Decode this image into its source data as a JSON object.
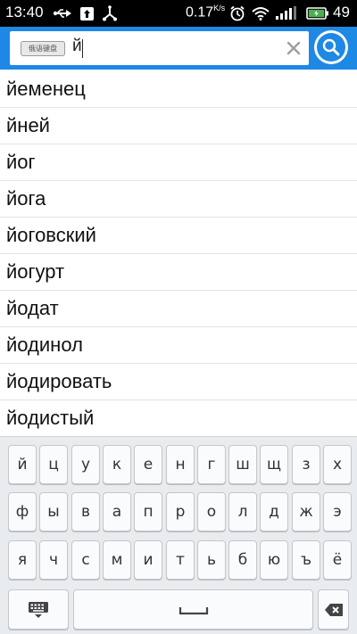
{
  "status_bar": {
    "time": "13:40",
    "network_speed": "0.17",
    "network_speed_unit": "K/s",
    "battery_level": "49",
    "icons": [
      "usb-icon",
      "upload-notification-icon",
      "usb-connection-icon",
      "alarm-clock-icon",
      "wifi-icon",
      "signal-icon",
      "battery-charging-icon"
    ]
  },
  "search": {
    "keyboard_chip_label": "俄语键盘",
    "query": "й",
    "clear_icon": "close-icon",
    "search_icon": "search-icon"
  },
  "suggestions": [
    "йеменец",
    "йней",
    "йог",
    "йога",
    "йоговский",
    "йогурт",
    "йодат",
    "йодинол",
    "йодировать",
    "йодистый"
  ],
  "keyboard": {
    "row1": [
      "й",
      "ц",
      "у",
      "к",
      "е",
      "н",
      "г",
      "ш",
      "щ",
      "з",
      "х"
    ],
    "row2": [
      "ф",
      "ы",
      "в",
      "а",
      "п",
      "р",
      "о",
      "л",
      "д",
      "ж",
      "э"
    ],
    "row3": [
      "я",
      "ч",
      "с",
      "м",
      "и",
      "т",
      "ь",
      "б",
      "ю",
      "ъ",
      "ё"
    ],
    "hide_icon": "keyboard-hide-icon",
    "space_icon": "space-bar-icon",
    "backspace_icon": "backspace-icon"
  },
  "colors": {
    "header_blue": "#1e88e5",
    "status_bar": "#000000",
    "keyboard_bg": "#e9ecef",
    "battery_green": "#4caf50"
  }
}
